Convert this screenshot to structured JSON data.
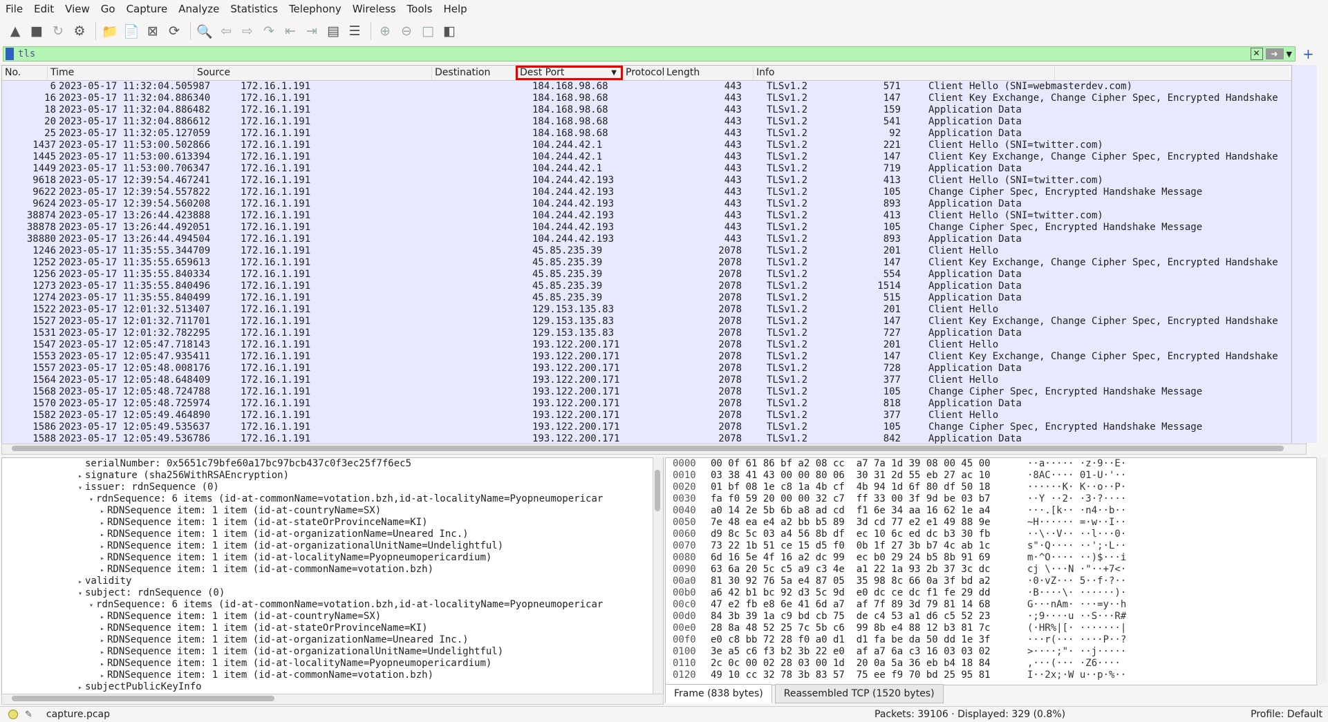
{
  "menu": [
    "File",
    "Edit",
    "View",
    "Go",
    "Capture",
    "Analyze",
    "Statistics",
    "Telephony",
    "Wireless",
    "Tools",
    "Help"
  ],
  "toolbar_icons": [
    "shark-fin-start-icon",
    "stop-icon",
    "restart-icon",
    "options-gear-icon",
    "open-folder-icon",
    "save-icon",
    "close-file-icon",
    "reload-icon",
    "find-icon",
    "back-arrow-icon",
    "forward-arrow-icon",
    "goto-packet-icon",
    "first-packet-icon",
    "last-packet-icon",
    "autoscroll-icon",
    "colorize-icon",
    "zoom-in-icon",
    "zoom-out-icon",
    "normal-size-icon",
    "resize-columns-icon"
  ],
  "filter": {
    "value": "tls"
  },
  "columns": {
    "no": "No.",
    "time": "Time",
    "source": "Source",
    "destination": "Destination",
    "dest_port": "Dest Port",
    "protocol": "Protocol",
    "length": "Length",
    "info": "Info"
  },
  "packets": [
    {
      "no": "6",
      "time": "2023-05-17 11:32:04.505987",
      "src": "172.16.1.191",
      "dst": "184.168.98.68",
      "dport": "443",
      "proto": "TLSv1.2",
      "len": "571",
      "info": "Client Hello (SNI=webmasterdev.com)"
    },
    {
      "no": "16",
      "time": "2023-05-17 11:32:04.886340",
      "src": "172.16.1.191",
      "dst": "184.168.98.68",
      "dport": "443",
      "proto": "TLSv1.2",
      "len": "147",
      "info": "Client Key Exchange, Change Cipher Spec, Encrypted Handshake"
    },
    {
      "no": "18",
      "time": "2023-05-17 11:32:04.886482",
      "src": "172.16.1.191",
      "dst": "184.168.98.68",
      "dport": "443",
      "proto": "TLSv1.2",
      "len": "159",
      "info": "Application Data"
    },
    {
      "no": "20",
      "time": "2023-05-17 11:32:04.886612",
      "src": "172.16.1.191",
      "dst": "184.168.98.68",
      "dport": "443",
      "proto": "TLSv1.2",
      "len": "541",
      "info": "Application Data"
    },
    {
      "no": "25",
      "time": "2023-05-17 11:32:05.127059",
      "src": "172.16.1.191",
      "dst": "184.168.98.68",
      "dport": "443",
      "proto": "TLSv1.2",
      "len": "92",
      "info": "Application Data"
    },
    {
      "no": "1437",
      "time": "2023-05-17 11:53:00.502866",
      "src": "172.16.1.191",
      "dst": "104.244.42.1",
      "dport": "443",
      "proto": "TLSv1.2",
      "len": "221",
      "info": "Client Hello (SNI=twitter.com)"
    },
    {
      "no": "1445",
      "time": "2023-05-17 11:53:00.613394",
      "src": "172.16.1.191",
      "dst": "104.244.42.1",
      "dport": "443",
      "proto": "TLSv1.2",
      "len": "147",
      "info": "Client Key Exchange, Change Cipher Spec, Encrypted Handshake"
    },
    {
      "no": "1449",
      "time": "2023-05-17 11:53:00.706347",
      "src": "172.16.1.191",
      "dst": "104.244.42.1",
      "dport": "443",
      "proto": "TLSv1.2",
      "len": "719",
      "info": "Application Data"
    },
    {
      "no": "9618",
      "time": "2023-05-17 12:39:54.467241",
      "src": "172.16.1.191",
      "dst": "104.244.42.193",
      "dport": "443",
      "proto": "TLSv1.2",
      "len": "413",
      "info": "Client Hello (SNI=twitter.com)"
    },
    {
      "no": "9622",
      "time": "2023-05-17 12:39:54.557822",
      "src": "172.16.1.191",
      "dst": "104.244.42.193",
      "dport": "443",
      "proto": "TLSv1.2",
      "len": "105",
      "info": "Change Cipher Spec, Encrypted Handshake Message"
    },
    {
      "no": "9624",
      "time": "2023-05-17 12:39:54.560208",
      "src": "172.16.1.191",
      "dst": "104.244.42.193",
      "dport": "443",
      "proto": "TLSv1.2",
      "len": "893",
      "info": "Application Data"
    },
    {
      "no": "38874",
      "time": "2023-05-17 13:26:44.423888",
      "src": "172.16.1.191",
      "dst": "104.244.42.193",
      "dport": "443",
      "proto": "TLSv1.2",
      "len": "413",
      "info": "Client Hello (SNI=twitter.com)"
    },
    {
      "no": "38878",
      "time": "2023-05-17 13:26:44.492051",
      "src": "172.16.1.191",
      "dst": "104.244.42.193",
      "dport": "443",
      "proto": "TLSv1.2",
      "len": "105",
      "info": "Change Cipher Spec, Encrypted Handshake Message"
    },
    {
      "no": "38880",
      "time": "2023-05-17 13:26:44.494504",
      "src": "172.16.1.191",
      "dst": "104.244.42.193",
      "dport": "443",
      "proto": "TLSv1.2",
      "len": "893",
      "info": "Application Data"
    },
    {
      "no": "1246",
      "time": "2023-05-17 11:35:55.344709",
      "src": "172.16.1.191",
      "dst": "45.85.235.39",
      "dport": "2078",
      "proto": "TLSv1.2",
      "len": "201",
      "info": "Client Hello"
    },
    {
      "no": "1252",
      "time": "2023-05-17 11:35:55.659613",
      "src": "172.16.1.191",
      "dst": "45.85.235.39",
      "dport": "2078",
      "proto": "TLSv1.2",
      "len": "147",
      "info": "Client Key Exchange, Change Cipher Spec, Encrypted Handshake"
    },
    {
      "no": "1256",
      "time": "2023-05-17 11:35:55.840334",
      "src": "172.16.1.191",
      "dst": "45.85.235.39",
      "dport": "2078",
      "proto": "TLSv1.2",
      "len": "554",
      "info": "Application Data"
    },
    {
      "no": "1273",
      "time": "2023-05-17 11:35:55.840496",
      "src": "172.16.1.191",
      "dst": "45.85.235.39",
      "dport": "2078",
      "proto": "TLSv1.2",
      "len": "1514",
      "info": "Application Data"
    },
    {
      "no": "1274",
      "time": "2023-05-17 11:35:55.840499",
      "src": "172.16.1.191",
      "dst": "45.85.235.39",
      "dport": "2078",
      "proto": "TLSv1.2",
      "len": "515",
      "info": "Application Data"
    },
    {
      "no": "1522",
      "time": "2023-05-17 12:01:32.513407",
      "src": "172.16.1.191",
      "dst": "129.153.135.83",
      "dport": "2078",
      "proto": "TLSv1.2",
      "len": "201",
      "info": "Client Hello"
    },
    {
      "no": "1527",
      "time": "2023-05-17 12:01:32.711701",
      "src": "172.16.1.191",
      "dst": "129.153.135.83",
      "dport": "2078",
      "proto": "TLSv1.2",
      "len": "147",
      "info": "Client Key Exchange, Change Cipher Spec, Encrypted Handshake"
    },
    {
      "no": "1531",
      "time": "2023-05-17 12:01:32.782295",
      "src": "172.16.1.191",
      "dst": "129.153.135.83",
      "dport": "2078",
      "proto": "TLSv1.2",
      "len": "727",
      "info": "Application Data"
    },
    {
      "no": "1547",
      "time": "2023-05-17 12:05:47.718143",
      "src": "172.16.1.191",
      "dst": "193.122.200.171",
      "dport": "2078",
      "proto": "TLSv1.2",
      "len": "201",
      "info": "Client Hello"
    },
    {
      "no": "1553",
      "time": "2023-05-17 12:05:47.935411",
      "src": "172.16.1.191",
      "dst": "193.122.200.171",
      "dport": "2078",
      "proto": "TLSv1.2",
      "len": "147",
      "info": "Client Key Exchange, Change Cipher Spec, Encrypted Handshake"
    },
    {
      "no": "1557",
      "time": "2023-05-17 12:05:48.008176",
      "src": "172.16.1.191",
      "dst": "193.122.200.171",
      "dport": "2078",
      "proto": "TLSv1.2",
      "len": "728",
      "info": "Application Data"
    },
    {
      "no": "1564",
      "time": "2023-05-17 12:05:48.648409",
      "src": "172.16.1.191",
      "dst": "193.122.200.171",
      "dport": "2078",
      "proto": "TLSv1.2",
      "len": "377",
      "info": "Client Hello"
    },
    {
      "no": "1568",
      "time": "2023-05-17 12:05:48.724788",
      "src": "172.16.1.191",
      "dst": "193.122.200.171",
      "dport": "2078",
      "proto": "TLSv1.2",
      "len": "105",
      "info": "Change Cipher Spec, Encrypted Handshake Message"
    },
    {
      "no": "1570",
      "time": "2023-05-17 12:05:48.725974",
      "src": "172.16.1.191",
      "dst": "193.122.200.171",
      "dport": "2078",
      "proto": "TLSv1.2",
      "len": "818",
      "info": "Application Data"
    },
    {
      "no": "1582",
      "time": "2023-05-17 12:05:49.464890",
      "src": "172.16.1.191",
      "dst": "193.122.200.171",
      "dport": "2078",
      "proto": "TLSv1.2",
      "len": "377",
      "info": "Client Hello"
    },
    {
      "no": "1586",
      "time": "2023-05-17 12:05:49.535637",
      "src": "172.16.1.191",
      "dst": "193.122.200.171",
      "dport": "2078",
      "proto": "TLSv1.2",
      "len": "105",
      "info": "Change Cipher Spec, Encrypted Handshake Message"
    },
    {
      "no": "1588",
      "time": "2023-05-17 12:05:49.536786",
      "src": "172.16.1.191",
      "dst": "193.122.200.171",
      "dport": "2078",
      "proto": "TLSv1.2",
      "len": "842",
      "info": "Application Data"
    }
  ],
  "details": [
    {
      "level": 6,
      "toggle": "",
      "text": "serialNumber: 0x5651c79bfe60a17bc97bcb437c0f3ec25f7f6ec5"
    },
    {
      "level": 6,
      "toggle": "closed",
      "text": "signature (sha256WithRSAEncryption)"
    },
    {
      "level": 6,
      "toggle": "open",
      "text": "issuer: rdnSequence (0)"
    },
    {
      "level": 7,
      "toggle": "open",
      "text": "rdnSequence: 6 items (id-at-commonName=votation.bzh,id-at-localityName=Pyopneumopericar"
    },
    {
      "level": 8,
      "toggle": "closed",
      "text": "RDNSequence item: 1 item (id-at-countryName=SX)"
    },
    {
      "level": 8,
      "toggle": "closed",
      "text": "RDNSequence item: 1 item (id-at-stateOrProvinceName=KI)"
    },
    {
      "level": 8,
      "toggle": "closed",
      "text": "RDNSequence item: 1 item (id-at-organizationName=Uneared Inc.)"
    },
    {
      "level": 8,
      "toggle": "closed",
      "text": "RDNSequence item: 1 item (id-at-organizationalUnitName=Undelightful)"
    },
    {
      "level": 8,
      "toggle": "closed",
      "text": "RDNSequence item: 1 item (id-at-localityName=Pyopneumopericardium)"
    },
    {
      "level": 8,
      "toggle": "closed",
      "text": "RDNSequence item: 1 item (id-at-commonName=votation.bzh)"
    },
    {
      "level": 6,
      "toggle": "closed",
      "text": "validity"
    },
    {
      "level": 6,
      "toggle": "open",
      "text": "subject: rdnSequence (0)"
    },
    {
      "level": 7,
      "toggle": "open",
      "text": "rdnSequence: 6 items (id-at-commonName=votation.bzh,id-at-localityName=Pyopneumopericar"
    },
    {
      "level": 8,
      "toggle": "closed",
      "text": "RDNSequence item: 1 item (id-at-countryName=SX)"
    },
    {
      "level": 8,
      "toggle": "closed",
      "text": "RDNSequence item: 1 item (id-at-stateOrProvinceName=KI)"
    },
    {
      "level": 8,
      "toggle": "closed",
      "text": "RDNSequence item: 1 item (id-at-organizationName=Uneared Inc.)"
    },
    {
      "level": 8,
      "toggle": "closed",
      "text": "RDNSequence item: 1 item (id-at-organizationalUnitName=Undelightful)"
    },
    {
      "level": 8,
      "toggle": "closed",
      "text": "RDNSequence item: 1 item (id-at-localityName=Pyopneumopericardium)"
    },
    {
      "level": 8,
      "toggle": "closed",
      "text": "RDNSequence item: 1 item (id-at-commonName=votation.bzh)"
    },
    {
      "level": 6,
      "toggle": "closed",
      "text": "subjectPublicKeyInfo"
    }
  ],
  "bytes": [
    {
      "off": "0000",
      "hex": "00 0f 61 86 bf a2 08 cc  a7 7a 1d 39 08 00 45 00",
      "asc": "··a····· ·z·9··E·"
    },
    {
      "off": "0010",
      "hex": "03 38 41 43 00 00 80 06  30 31 2d 55 eb 27 ac 10",
      "asc": "·8AC···· 01-U·'··"
    },
    {
      "off": "0020",
      "hex": "01 bf 08 1e c8 1a 4b cf  4b 94 1d 6f 80 df 50 18",
      "asc": "······K· K··o··P·"
    },
    {
      "off": "0030",
      "hex": "fa f0 59 20 00 00 32 c7  ff 33 00 3f 9d be 03 b7",
      "asc": "··Y ··2· ·3·?····"
    },
    {
      "off": "0040",
      "hex": "a0 14 2e 5b 6b a8 ad cd  f1 6e 34 aa 16 62 1e a4",
      "asc": "···.[k·· ·n4··b··"
    },
    {
      "off": "0050",
      "hex": "7e 48 ea e4 a2 bb b5 89  3d cd 77 e2 e1 49 88 9e",
      "asc": "~H······ =·w··I··"
    },
    {
      "off": "0060",
      "hex": "d9 8c 5c 03 a4 56 8b df  ec 10 6c ed dc b3 30 fb",
      "asc": "··\\··V·· ··l···0·"
    },
    {
      "off": "0070",
      "hex": "73 22 1b 51 ce 15 d5 f0  0b 1f 27 3b b7 4c ab 1c",
      "asc": "s\"·Q···· ··';·L··"
    },
    {
      "off": "0080",
      "hex": "6d 16 5e 4f 16 a2 dc 99  ec b0 29 24 b5 8b 91 69",
      "asc": "m·^O···· ··)$···i"
    },
    {
      "off": "0090",
      "hex": "63 6a 20 5c c5 a9 c3 4e  a1 22 1a 93 2b 37 3c dc",
      "asc": "cj \\···N ·\"··+7<·"
    },
    {
      "off": "00a0",
      "hex": "81 30 92 76 5a e4 87 05  35 98 8c 66 0a 3f bd a2",
      "asc": "·0·vZ··· 5··f·?··"
    },
    {
      "off": "00b0",
      "hex": "a6 42 b1 bc 92 d3 5c 9d  e0 dc ce dc f1 fe 29 dd",
      "asc": "·B····\\· ······)·"
    },
    {
      "off": "00c0",
      "hex": "47 e2 fb e8 6e 41 6d a7  af 7f 89 3d 79 81 14 68",
      "asc": "G···nAm· ···=y··h"
    },
    {
      "off": "00d0",
      "hex": "84 3b 39 1a c9 bd cb 75  de c4 53 a1 d6 c5 52 23",
      "asc": "·;9····u ··S···R#"
    },
    {
      "off": "00e0",
      "hex": "28 8a 48 52 25 7c 5b c6  99 8b e4 88 12 b3 81 7c",
      "asc": "(·HR%|[· ·······|"
    },
    {
      "off": "00f0",
      "hex": "e0 c8 bb 72 28 f0 a0 d1  d1 fa be da 50 dd 1e 3f",
      "asc": "···r(··· ····P··?"
    },
    {
      "off": "0100",
      "hex": "3e a5 c6 f3 b2 3b 22 e0  af a7 6a c3 16 03 03 02",
      "asc": ">····;\"· ··j·····"
    },
    {
      "off": "0110",
      "hex": "2c 0c 00 02 28 03 00 1d  20 0a 5a 36 eb b4 18 84",
      "asc": ",···(··· ·Z6····"
    },
    {
      "off": "0120",
      "hex": "49 10 cc 32 78 3b 83 57  75 ee f9 70 bd 25 95 81",
      "asc": "I··2x;·W u··p·%··"
    }
  ],
  "byte_tabs": [
    "Frame (838 bytes)",
    "Reassembled TCP (1520 bytes)"
  ],
  "status": {
    "file": "capture.pcap",
    "packets": "Packets: 39106 · Displayed: 329 (0.8%)",
    "profile": "Profile: Default"
  }
}
